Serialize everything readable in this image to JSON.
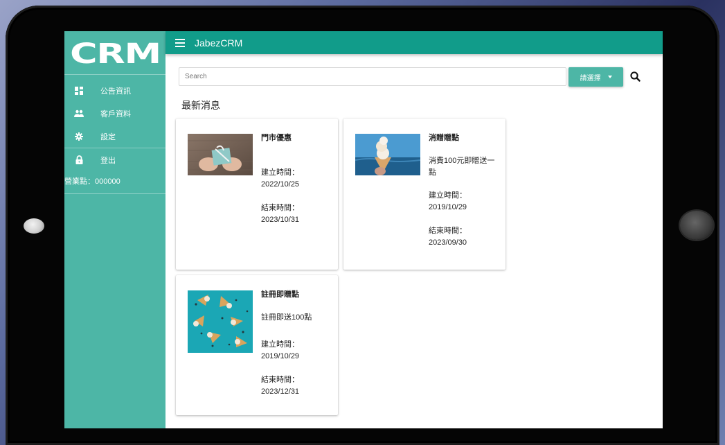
{
  "sidebar": {
    "logo": "CRM",
    "items": [
      {
        "label": "公告資訊",
        "icon": "dashboard-icon"
      },
      {
        "label": "客戶資料",
        "icon": "people-icon"
      },
      {
        "label": "設定",
        "icon": "gear-icon"
      },
      {
        "label": "登出",
        "icon": "lock-icon"
      }
    ],
    "store_label": "營業點：000000"
  },
  "header": {
    "title": "JabezCRM"
  },
  "search": {
    "placeholder": "Search",
    "select_label": "請選擇"
  },
  "section_title": "最新消息",
  "cards": [
    {
      "title": "門市優惠",
      "description": "",
      "start_label": "建立時間：",
      "start_date": "2022/10/25",
      "end_label": "結束時間：",
      "end_date": "2023/10/31"
    },
    {
      "title": "消贈贈點",
      "description": "消費100元即贈送一點",
      "start_label": "建立時間：",
      "start_date": "2019/10/29",
      "end_label": "結束時間：",
      "end_date": "2023/09/30"
    },
    {
      "title": "註冊即贈點",
      "description": "註冊即送100點",
      "start_label": "建立時間：",
      "start_date": "2019/10/29",
      "end_label": "結束時間：",
      "end_date": "2023/12/31"
    }
  ],
  "colors": {
    "sidebar": "#4db6a6",
    "topbar": "#119c8a",
    "accent": "#4db6a6"
  }
}
